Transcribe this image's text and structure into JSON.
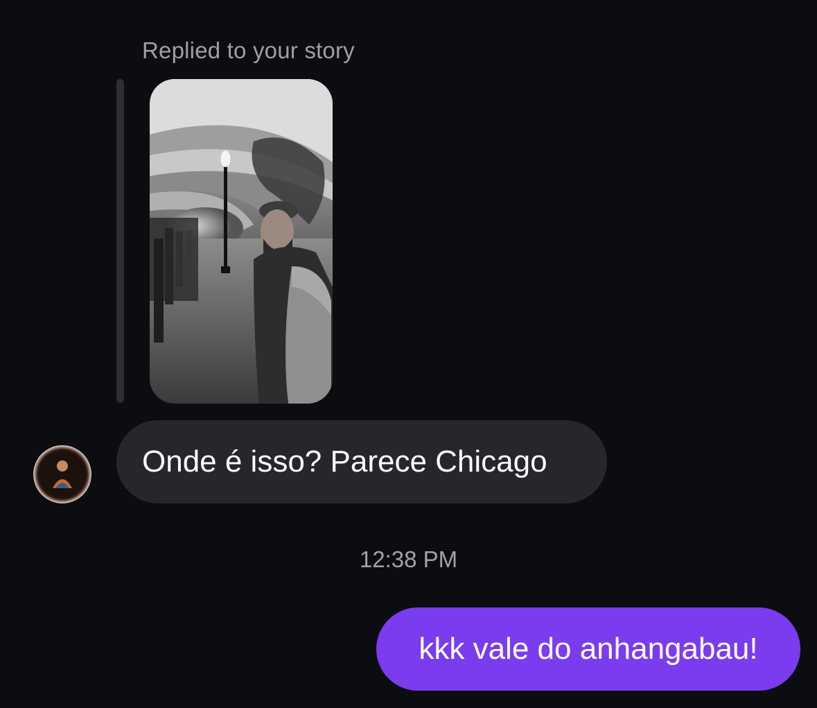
{
  "conversation": {
    "reply_label": "Replied to your story",
    "story_image": "story-photo (black-and-white arched tunnel with man in jacket)",
    "incoming_message": "Onde é isso? Parece Chicago",
    "timestamp": "12:38 PM",
    "outgoing_message": "kkk vale do anhangabau!"
  },
  "colors": {
    "background": "#0c0d11",
    "incoming_bubble": "#25272c",
    "outgoing_bubble": "#7a3cee",
    "secondary_text": "#9ea0a8"
  },
  "icons": {
    "avatar": "sender-avatar"
  }
}
